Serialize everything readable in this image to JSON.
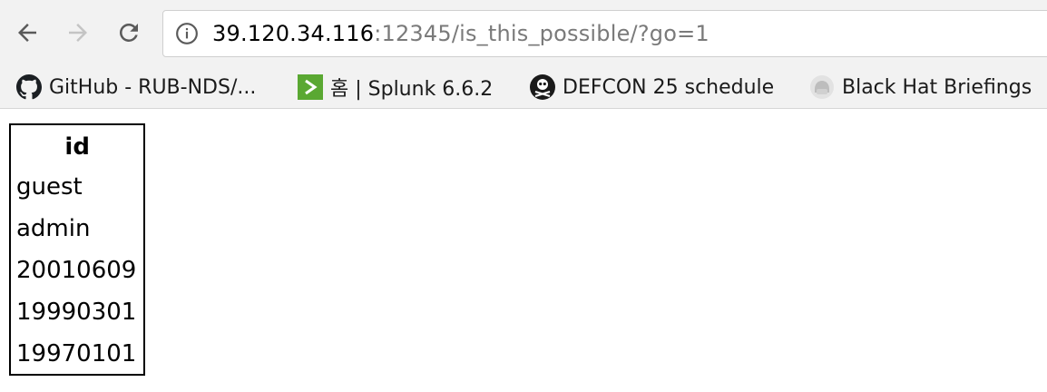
{
  "browser": {
    "url_host": "39.120.34.116",
    "url_rest": ":12345/is_this_possible/?go=1"
  },
  "bookmarks": [
    {
      "label": "GitHub - RUB-NDS/...",
      "icon": "github-icon"
    },
    {
      "label": "홈 | Splunk 6.6.2",
      "icon": "splunk-icon"
    },
    {
      "label": "DEFCON 25 schedule",
      "icon": "defcon-icon"
    },
    {
      "label": "Black Hat Briefings",
      "icon": "blackhat-icon"
    }
  ],
  "table": {
    "header": "id",
    "rows": [
      "guest",
      "admin",
      "20010609",
      "19990301",
      "19970101"
    ]
  }
}
